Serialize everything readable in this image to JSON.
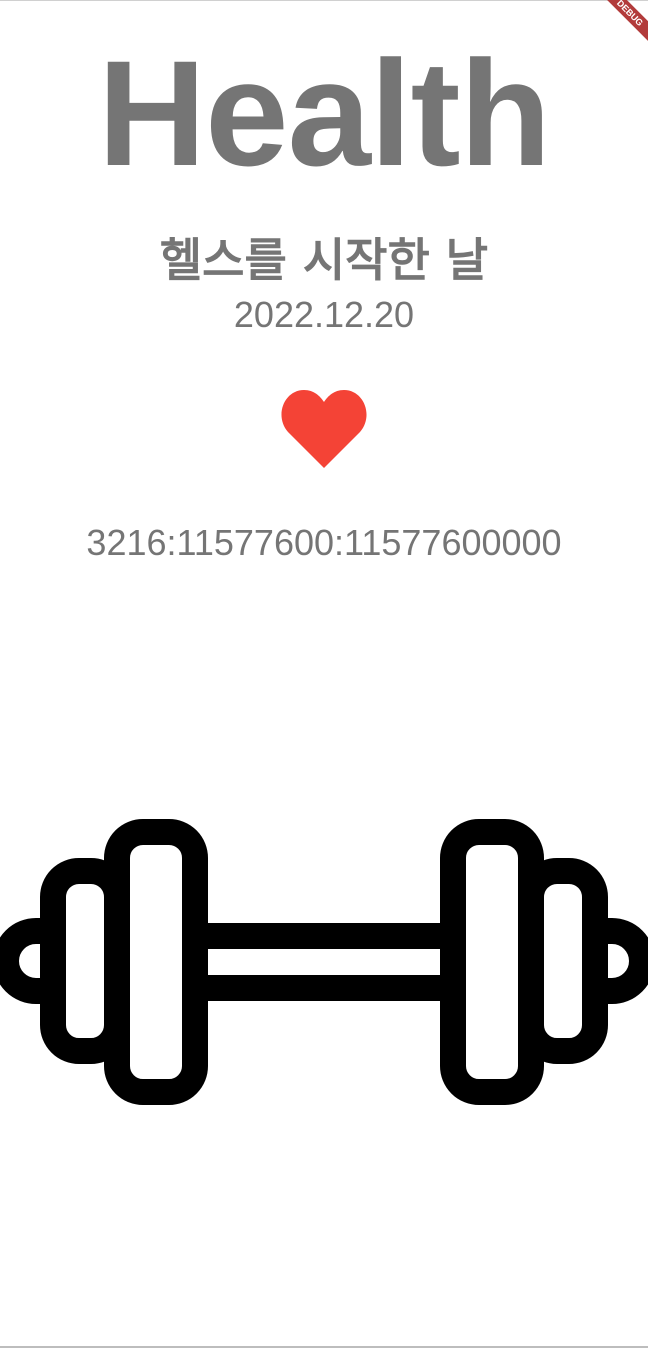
{
  "banner": {
    "label": "DEBUG"
  },
  "header": {
    "title": "Health"
  },
  "start": {
    "label": "헬스를 시작한 날",
    "date": "2022.12.20"
  },
  "counter": {
    "value": "3216:11577600:11577600000"
  },
  "icons": {
    "heart": "heart-icon",
    "dumbbell": "dumbbell-icon"
  },
  "colors": {
    "text": "#757575",
    "heart": "#f44336",
    "icon": "#000000",
    "background": "#ffffff",
    "banner": "#b23b3b"
  }
}
